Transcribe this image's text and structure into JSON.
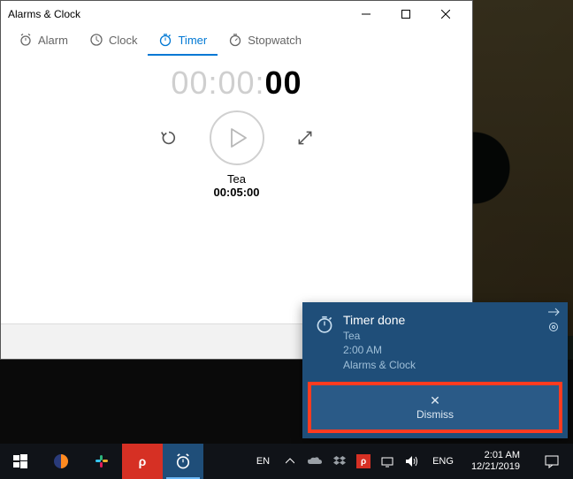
{
  "window": {
    "title": "Alarms & Clock",
    "tabs": {
      "alarm": "Alarm",
      "clock": "Clock",
      "timer": "Timer",
      "stopwatch": "Stopwatch"
    },
    "timer": {
      "display_inactive": "00:00:",
      "display_active": "00",
      "name": "Tea",
      "duration": "00:05:00"
    },
    "add_label": "+"
  },
  "toast": {
    "title": "Timer done",
    "line1": "Tea",
    "line2": "2:00 AM",
    "line3": "Alarms & Clock",
    "dismiss_label": "Dismiss"
  },
  "taskbar": {
    "lang_left": "EN",
    "lang_right": "ENG",
    "time": "2:01 AM",
    "date": "12/21/2019"
  }
}
